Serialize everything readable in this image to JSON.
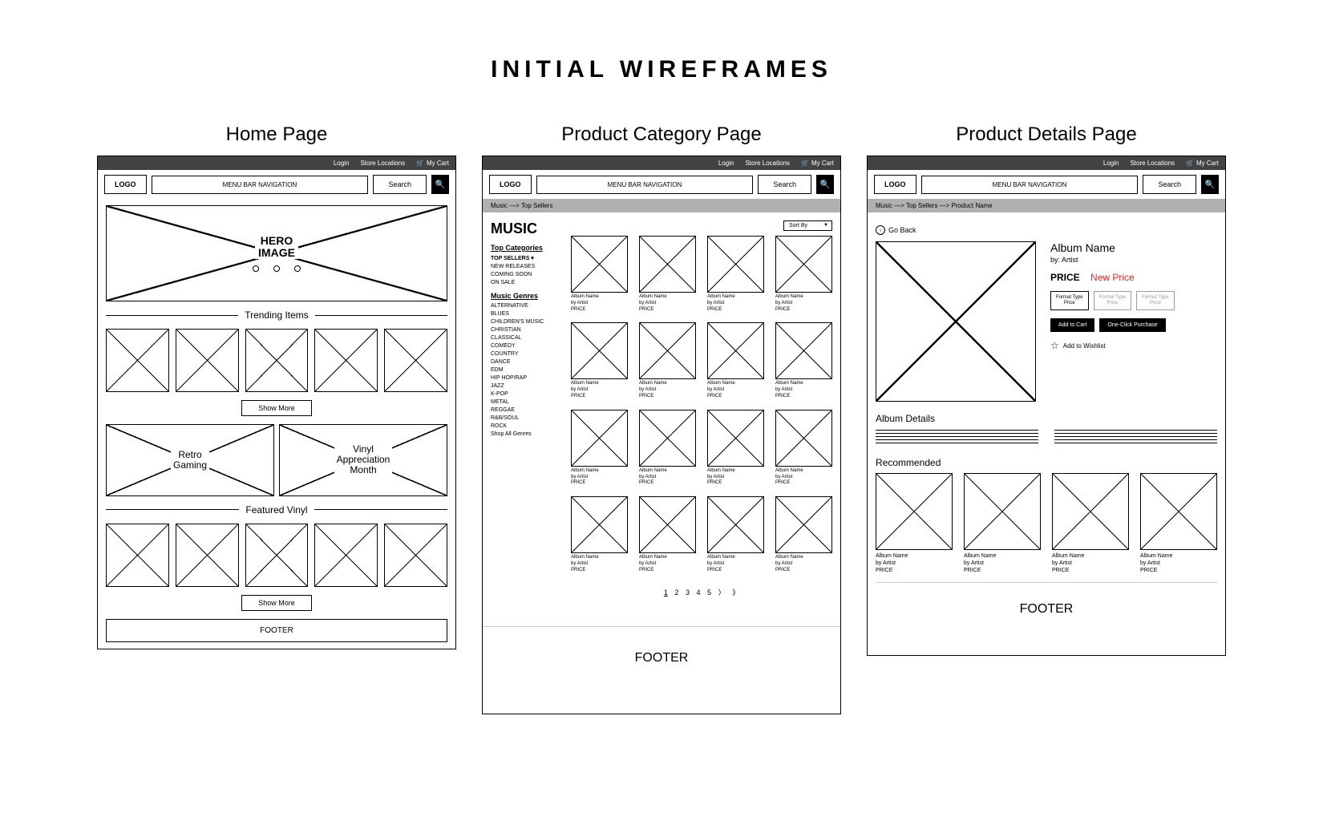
{
  "title": "INITIAL WIREFRAMES",
  "panels": {
    "home": "Home Page",
    "category": "Product Category Page",
    "details": "Product Details Page"
  },
  "topbar": {
    "login": "Login",
    "locations": "Store Locations",
    "cart": "My Cart"
  },
  "nav": {
    "logo": "LOGO",
    "menu": "MENU BAR NAVIGATION",
    "search": "Search"
  },
  "home": {
    "hero": "HERO\nIMAGE",
    "trending": "Trending Items",
    "showMore": "Show More",
    "retro": "Retro\nGaming",
    "vinyl": "Vinyl\nAppreciation\nMonth",
    "featured": "Featured Vinyl",
    "footer": "FOOTER"
  },
  "category": {
    "crumbs": "Music  —>  Top Sellers",
    "heading": "MUSIC",
    "topCat": "Top Categories",
    "topCatItems": [
      "TOP SELLERS ▾",
      "NEW RELEASES",
      "COMING SOON",
      "ON SALE"
    ],
    "genresHdr": "Music Genres",
    "genres": [
      "ALTERNATIVE",
      "BLUES",
      "CHILDREN'S MUSIC",
      "CHRISTIAN",
      "CLASSICAL",
      "COMEDY",
      "COUNTRY",
      "DANCE",
      "EDM",
      "HIP HOP/RAP",
      "JAZZ",
      "K-POP",
      "METAL",
      "REGGAE",
      "R&B/SOUL",
      "ROCK",
      "Shop All Genres"
    ],
    "sort": "Sort By",
    "cardName": "Album Name",
    "cardArtist": "by Artist",
    "cardPrice": "PRICE",
    "pages": [
      "1",
      "2",
      "3",
      "4",
      "5"
    ],
    "next": "〉",
    "last": "》",
    "footer": "FOOTER"
  },
  "details": {
    "crumbs": "Music  —>  Top Sellers  —>  Product Name",
    "goBack": "Go Back",
    "album": "Album Name",
    "by": "by: Artist",
    "price": "PRICE",
    "newPrice": "New Price",
    "fmtLabel": "Format Type",
    "fmtPrice": "Price",
    "addCart": "Add to Cart",
    "oneClick": "One-Click Purchase",
    "wishlist": "Add to Wishlist",
    "albumDetails": "Album Details",
    "recommended": "Recommended",
    "cardName": "Album Name",
    "cardArtist": "by Artist",
    "cardPrice": "PRICE",
    "footer": "FOOTER"
  }
}
